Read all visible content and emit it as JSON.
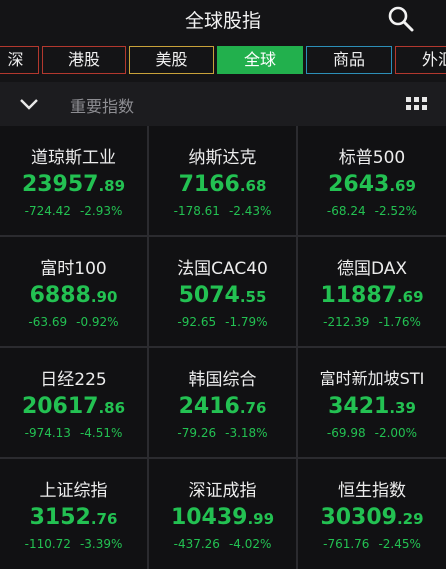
{
  "header": {
    "title": "全球股指"
  },
  "tabs": [
    {
      "label": "深",
      "active": false
    },
    {
      "label": "港股",
      "active": false
    },
    {
      "label": "美股",
      "active": false
    },
    {
      "label": "全球",
      "active": true
    },
    {
      "label": "商品",
      "active": false
    },
    {
      "label": "外汇",
      "active": false
    }
  ],
  "subbar": {
    "label": "重要指数"
  },
  "colors": {
    "down": "#23c152",
    "active_tab": "#22b04d",
    "tab_border": "#b3382e"
  },
  "indices": [
    {
      "name": "道琼斯工业",
      "price_int": "23957",
      "price_dec": ".89",
      "change": "-724.42",
      "pct": "-2.93%"
    },
    {
      "name": "纳斯达克",
      "price_int": "7166",
      "price_dec": ".68",
      "change": "-178.61",
      "pct": "-2.43%"
    },
    {
      "name": "标普500",
      "price_int": "2643",
      "price_dec": ".69",
      "change": "-68.24",
      "pct": "-2.52%"
    },
    {
      "name": "富时100",
      "price_int": "6888",
      "price_dec": ".90",
      "change": "-63.69",
      "pct": "-0.92%"
    },
    {
      "name": "法国CAC40",
      "price_int": "5074",
      "price_dec": ".55",
      "change": "-92.65",
      "pct": "-1.79%"
    },
    {
      "name": "德国DAX",
      "price_int": "11887",
      "price_dec": ".69",
      "change": "-212.39",
      "pct": "-1.76%"
    },
    {
      "name": "日经225",
      "price_int": "20617",
      "price_dec": ".86",
      "change": "-974.13",
      "pct": "-4.51%"
    },
    {
      "name": "韩国综合",
      "price_int": "2416",
      "price_dec": ".76",
      "change": "-79.26",
      "pct": "-3.18%"
    },
    {
      "name": "富时新加坡STI",
      "price_int": "3421",
      "price_dec": ".39",
      "change": "-69.98",
      "pct": "-2.00%"
    },
    {
      "name": "上证综指",
      "price_int": "3152",
      "price_dec": ".76",
      "change": "-110.72",
      "pct": "-3.39%"
    },
    {
      "name": "深证成指",
      "price_int": "10439",
      "price_dec": ".99",
      "change": "-437.26",
      "pct": "-4.02%"
    },
    {
      "name": "恒生指数",
      "price_int": "30309",
      "price_dec": ".29",
      "change": "-761.76",
      "pct": "-2.45%"
    }
  ]
}
